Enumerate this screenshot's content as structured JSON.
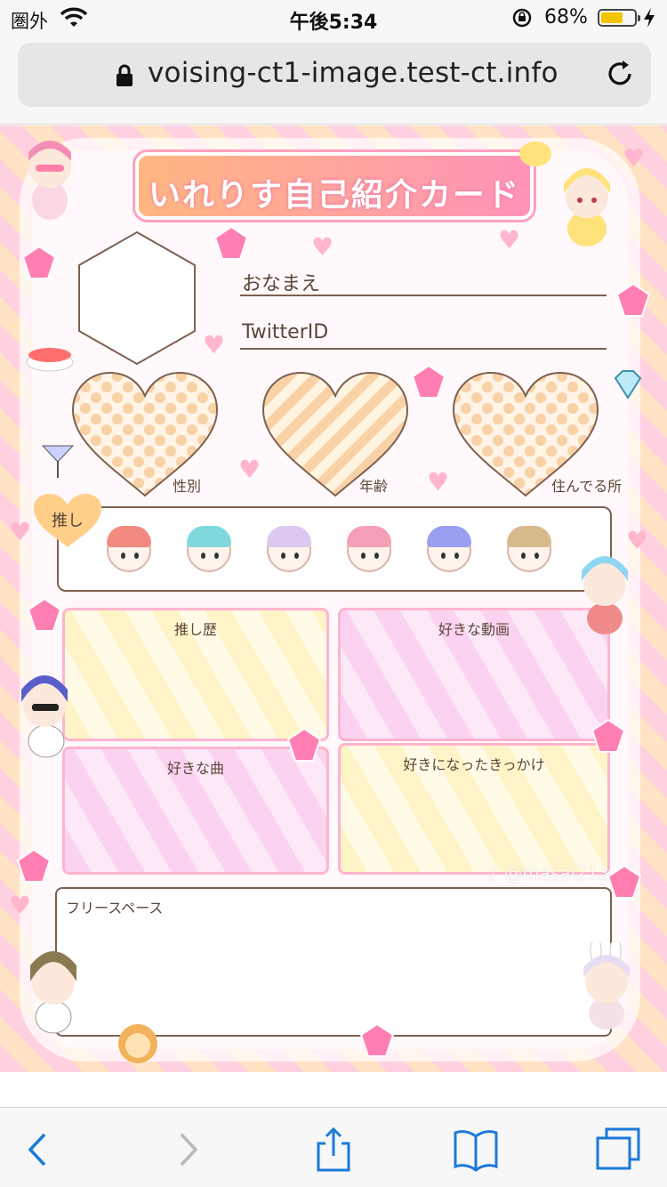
{
  "status_bar": {
    "carrier": "圏外",
    "time": "午後5:34",
    "battery_percent": "68%",
    "battery_level": 0.68,
    "icons": [
      "wifi-icon",
      "rotation-lock-icon",
      "battery-icon",
      "charging-bolt-icon"
    ]
  },
  "browser": {
    "url": "voising-ct1-image.test-ct.info",
    "icons": [
      "lock-icon",
      "reload-icon"
    ]
  },
  "card": {
    "title": "いれりす自己紹介カード",
    "fields": {
      "name_label": "おなまえ",
      "twitter_label": "TwitterID"
    },
    "hearts": [
      "性別",
      "年齢",
      "住んでる所"
    ],
    "oshi_tag": "推し",
    "members": [
      {
        "name": "red-member",
        "hair": "#f28a80"
      },
      {
        "name": "cyan-member",
        "hair": "#7fd9dc"
      },
      {
        "name": "lavender-member",
        "hair": "#dcc9f0"
      },
      {
        "name": "pink-member",
        "hair": "#f59fb6"
      },
      {
        "name": "blue-member",
        "hair": "#9a9ff0"
      },
      {
        "name": "beige-member",
        "hair": "#d8b98a"
      }
    ],
    "panels": {
      "oshi_history": "推し歴",
      "favorite_video": "好きな動画",
      "favorite_song": "好きな曲",
      "reason": "好きになったきっかけ"
    },
    "free_space": "フリースペース",
    "watermark": "♪ @masai213"
  },
  "toolbar": {
    "buttons": [
      "back-button",
      "forward-button",
      "share-button",
      "bookmarks-button",
      "tabs-button"
    ]
  },
  "colors": {
    "accent_blue": "#1a7ad9",
    "title_gradient_start": "#ffb780",
    "title_gradient_end": "#ff93b8",
    "battery_fill": "#f5c400"
  }
}
